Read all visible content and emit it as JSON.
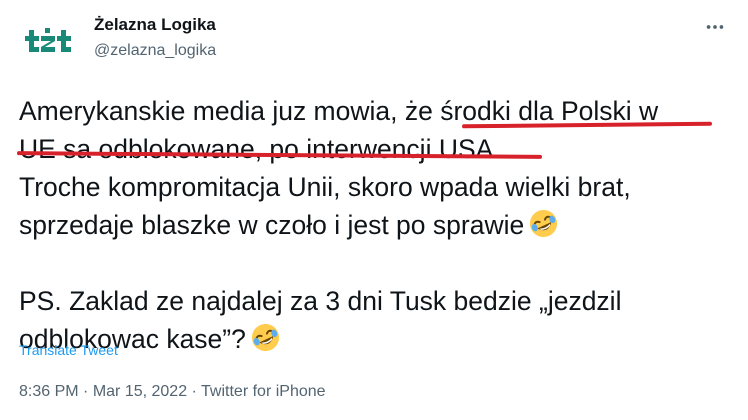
{
  "author": {
    "name": "Żelazna Logika",
    "handle": "@zelazna_logika",
    "avatar_text": "tżt"
  },
  "tweet": {
    "lines": [
      "Amerykanskie media juz mowia, że środki dla Polski w",
      "UE sa odblokowane, po interwencji USA.",
      "Troche kompromitacja Unii, skoro wpada wielki brat,",
      "sprzedaje blaszke w czoło i jest po sprawie",
      "PS. Zaklad ze najdalej za 3 dni Tusk bedzie „jezdzil",
      "odblokowac kase”?"
    ],
    "emoji": "rolling-on-the-floor-laughing"
  },
  "translate_label": "Translate Tweet",
  "meta": {
    "time": "8:36 PM",
    "separator": " · ",
    "date": "Mar 15, 2022",
    "source": "Twitter for iPhone"
  },
  "colors": {
    "text": "#0f1419",
    "secondary": "#536471",
    "link": "#1d9bf0",
    "annotation_underline": "#d8222b",
    "avatar_green": "#1a8a78"
  },
  "icons": {
    "more": "more-horizontal-icon"
  }
}
